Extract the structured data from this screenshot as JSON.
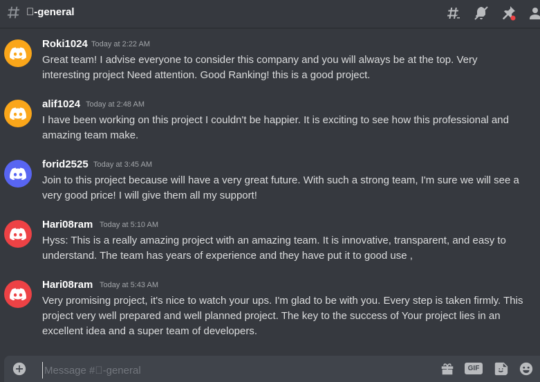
{
  "header": {
    "channel_name": "\u0000-general",
    "icons": [
      "hash-icon",
      "threads-icon",
      "notification-muted-icon",
      "pin-icon",
      "member-list-icon"
    ]
  },
  "colors": {
    "background": "#36393f",
    "avatar_orange": "#faa61a",
    "avatar_blurple": "#5865f2",
    "avatar_red": "#ed4245",
    "unread_dot": "#ed4245"
  },
  "messages": [
    {
      "username": "Roki1024",
      "timestamp": "Today at 2:22 AM",
      "avatar_color": "#faa61a",
      "text": "Great team! I advise everyone to consider this company and you will always be at the top. Very interesting project Need attention. Good Ranking! this is a good project."
    },
    {
      "username": "alif1024",
      "timestamp": "Today at 2:48 AM",
      "avatar_color": "#faa61a",
      "text": "I have been working on this project I couldn't be happier. It is exciting to see how this professional and amazing team make."
    },
    {
      "username": "forid2525",
      "timestamp": "Today at 3:45 AM",
      "avatar_color": "#5865f2",
      "text": "Join to this project because will have a very great future. With such a strong team, I'm sure we will see a very good price! I will give them all my support!"
    },
    {
      "username": "Hari08ram",
      "timestamp": "Today at 5:10 AM",
      "avatar_color": "#ed4245",
      "text": "Hyss: This is a really amazing project with an amazing team. It is innovative, transparent, and easy to understand. The team has years of experience and they have put it to good use ,"
    },
    {
      "username": "Hari08ram",
      "timestamp": "Today at 5:43 AM",
      "avatar_color": "#ed4245",
      "text": "Very promising project, it's nice to watch your ups. I'm glad to be with you. Every step is taken firmly. This project very well prepared and well planned project.  The key to the success of Your project lies in an excellent idea and a super team of developers."
    }
  ],
  "composer": {
    "placeholder": "Message #\u0000-general",
    "value": "",
    "gif_label": "GIF"
  }
}
